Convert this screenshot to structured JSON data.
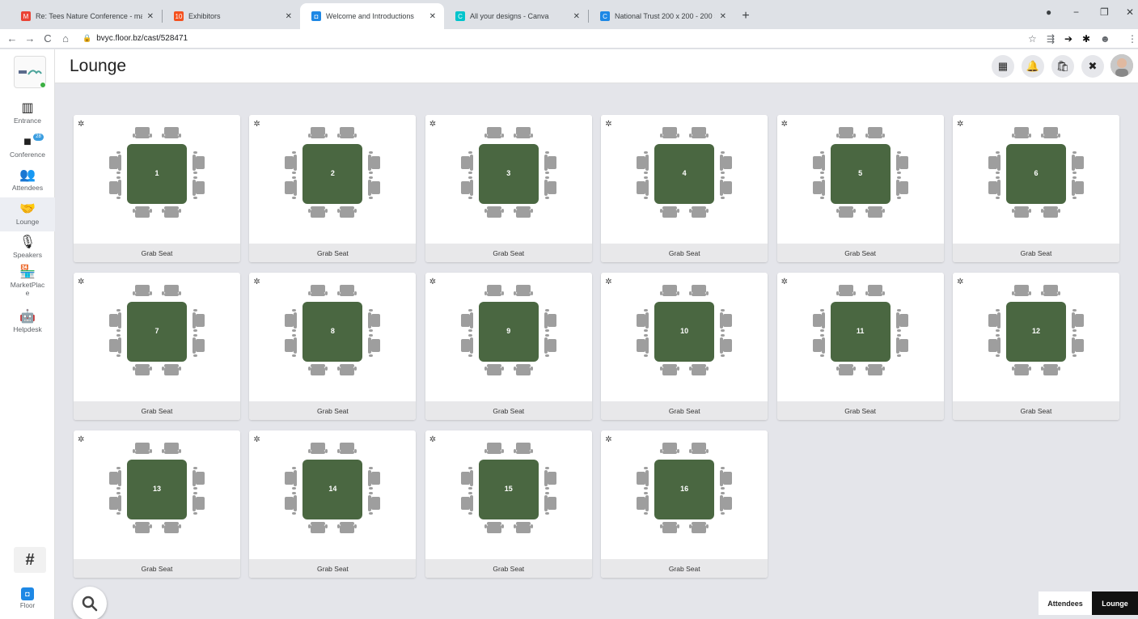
{
  "browser": {
    "tabs": [
      {
        "title": "Re: Tees Nature Conference - ma",
        "icon": "gmail-icon",
        "color": "#ea4335",
        "glyph": "M"
      },
      {
        "title": "Exhibitors",
        "icon": "exhibitors-icon",
        "color": "#f4511e",
        "glyph": "10"
      },
      {
        "title": "Welcome and Introductions",
        "icon": "floor-icon",
        "color": "#1e88e5",
        "glyph": "◘"
      },
      {
        "title": "All your designs - Canva",
        "icon": "canva-icon",
        "color": "#00c4cc",
        "glyph": "C"
      },
      {
        "title": "National Trust 200 x 200 - 200 ×",
        "icon": "canva-icon",
        "color": "#1e88e5",
        "glyph": "C"
      }
    ],
    "url": "bvyc.floor.bz/cast/528471"
  },
  "sidebar": {
    "items": [
      {
        "label": "Entrance",
        "icon": "map-icon",
        "glyph": "▥"
      },
      {
        "label": "Conference",
        "icon": "video-icon",
        "glyph": "■",
        "badge": "28"
      },
      {
        "label": "Attendees",
        "icon": "people-icon",
        "glyph": "👥"
      },
      {
        "label": "Lounge",
        "icon": "handshake-icon",
        "glyph": "🤝"
      },
      {
        "label": "Speakers",
        "icon": "microphone-icon",
        "glyph": "🎙"
      },
      {
        "label": "MarketPlac e",
        "icon": "store-icon",
        "glyph": "🏪"
      },
      {
        "label": "Helpdesk",
        "icon": "robot-icon",
        "glyph": "🤖"
      }
    ],
    "hash": "#",
    "footer_label": "Floor"
  },
  "header": {
    "title": "Lounge"
  },
  "tables": [
    {
      "number": "1",
      "action": "Grab Seat"
    },
    {
      "number": "2",
      "action": "Grab Seat"
    },
    {
      "number": "3",
      "action": "Grab Seat"
    },
    {
      "number": "4",
      "action": "Grab Seat"
    },
    {
      "number": "5",
      "action": "Grab Seat"
    },
    {
      "number": "6",
      "action": "Grab Seat"
    },
    {
      "number": "7",
      "action": "Grab Seat"
    },
    {
      "number": "8",
      "action": "Grab Seat"
    },
    {
      "number": "9",
      "action": "Grab Seat"
    },
    {
      "number": "10",
      "action": "Grab Seat"
    },
    {
      "number": "11",
      "action": "Grab Seat"
    },
    {
      "number": "12",
      "action": "Grab Seat"
    },
    {
      "number": "13",
      "action": "Grab Seat"
    },
    {
      "number": "14",
      "action": "Grab Seat"
    },
    {
      "number": "15",
      "action": "Grab Seat"
    },
    {
      "number": "16",
      "action": "Grab Seat"
    }
  ],
  "bottom": {
    "attendees_label": "Attendees",
    "lounge_label": "Lounge"
  },
  "colors": {
    "table": "#4a6741",
    "chair": "#9e9e9e",
    "active_toggle": "#111111"
  }
}
